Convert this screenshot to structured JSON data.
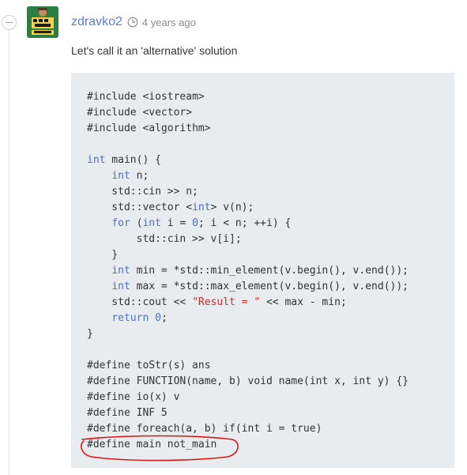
{
  "comment": {
    "username": "zdravko2",
    "timestamp": "4 years ago",
    "text": "Let's call it an 'alternative' solution"
  },
  "code": {
    "include_kw": "#include",
    "includes": [
      "<iostream>",
      "<vector>",
      "<algorithm>"
    ],
    "main_sig": [
      "int",
      " main() {"
    ],
    "body": {
      "l1": [
        "    ",
        "int",
        " n;"
      ],
      "l2": "    std::cin >> n;",
      "l3": [
        "    std::vector <",
        "int",
        "> v(n);"
      ],
      "l4": [
        "    ",
        "for",
        " (",
        "int",
        " i = ",
        "0",
        "; i < n; ++i) {"
      ],
      "l5": "        std::cin >> v[i];",
      "l6": "    }",
      "l7": [
        "    ",
        "int",
        " min = *std::min_element(v.begin(), v.end());"
      ],
      "l8": [
        "    ",
        "int",
        " max = *std::max_element(v.begin(), v.end());"
      ],
      "l9": [
        "    std::cout << ",
        "\"Result = \"",
        " << max - min;"
      ],
      "l10": [
        "    ",
        "return",
        " ",
        "0",
        ";"
      ],
      "l11": "}"
    },
    "defines": [
      "#define toStr(s) ans",
      "#define FUNCTION(name, b) void name(int x, int y) {}",
      "#define io(x) v",
      "#define INF 5",
      "#define foreach(a, b) if(int i = true)",
      "#define main not_main"
    ]
  },
  "colors": {
    "username": "#5a7fd1",
    "keyword": "#4c6fc9",
    "string": "#c8302f",
    "code_bg": "#e8ecee",
    "highlight": "#d9161a"
  },
  "icons": {
    "clock": "clock-icon",
    "collapse": "minus-circle-icon",
    "avatar": "avatar-image"
  }
}
